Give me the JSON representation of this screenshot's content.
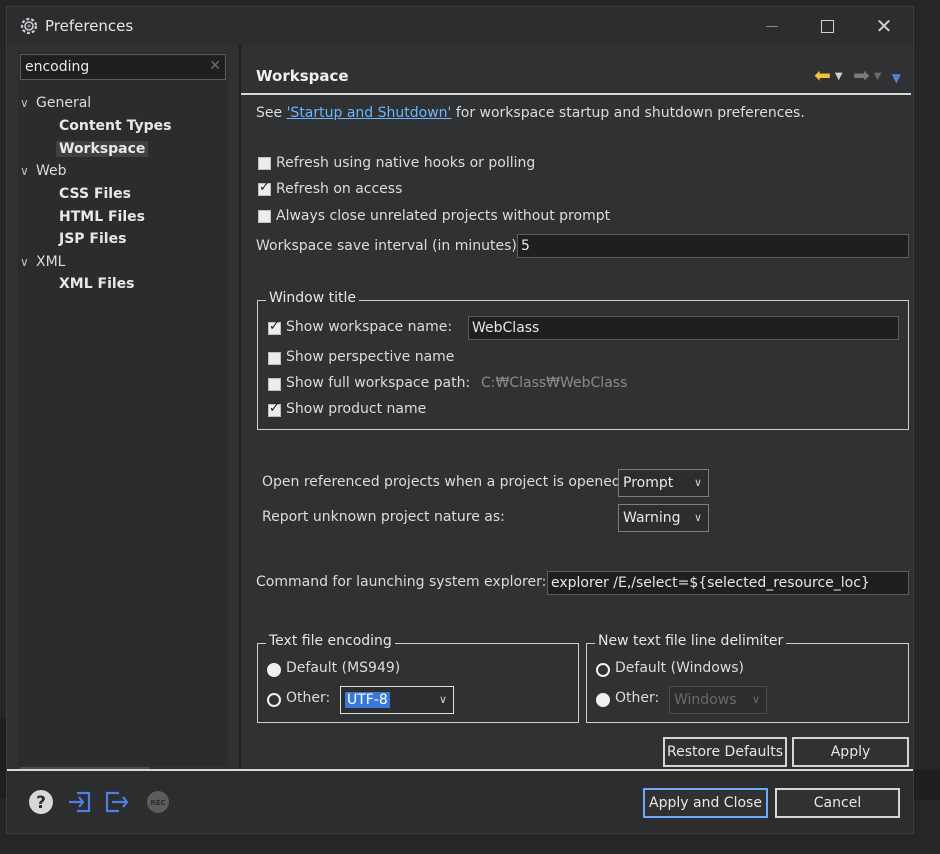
{
  "window": {
    "title": "Preferences"
  },
  "filter": {
    "value": "encoding"
  },
  "tree": [
    {
      "label": "General",
      "level": 0,
      "expanded": true
    },
    {
      "label": "Content Types",
      "level": 1
    },
    {
      "label": "Workspace",
      "level": 1,
      "selected": true
    },
    {
      "label": "Web",
      "level": 0,
      "expanded": true
    },
    {
      "label": "CSS Files",
      "level": 1
    },
    {
      "label": "HTML Files",
      "level": 1
    },
    {
      "label": "JSP Files",
      "level": 1
    },
    {
      "label": "XML",
      "level": 0,
      "expanded": true
    },
    {
      "label": "XML Files",
      "level": 1
    }
  ],
  "page": {
    "title": "Workspace",
    "intro_prefix": "See ",
    "intro_link": "'Startup and Shutdown'",
    "intro_suffix": " for workspace startup and shutdown preferences.",
    "refresh_native": {
      "label": "Refresh using native hooks or polling",
      "checked": false
    },
    "refresh_access": {
      "label": "Refresh on access",
      "checked": true
    },
    "always_close": {
      "label": "Always close unrelated projects without prompt",
      "checked": false
    },
    "save_interval": {
      "label": "Workspace save interval (in minutes):",
      "value": "5"
    },
    "window_title": {
      "group_label": "Window title",
      "show_workspace_name": {
        "label": "Show workspace name:",
        "checked": true,
        "value": "WebClass"
      },
      "show_perspective_name": {
        "label": "Show perspective name",
        "checked": false
      },
      "show_full_path": {
        "label": "Show full workspace path:",
        "checked": false,
        "value": "C:₩Class₩WebClass"
      },
      "show_product_name": {
        "label": "Show product name",
        "checked": true
      }
    },
    "open_referenced": {
      "label": "Open referenced projects when a project is opened:",
      "value": "Prompt"
    },
    "report_unknown": {
      "label": "Report unknown project nature as:",
      "value": "Warning"
    },
    "explorer_cmd": {
      "label": "Command for launching system explorer:",
      "value": "explorer /E,/select=${selected_resource_loc}"
    },
    "encoding": {
      "group_label": "Text file encoding",
      "default_label": "Default (MS949)",
      "other_label": "Other:",
      "other_value": "UTF-8"
    },
    "line_delim": {
      "group_label": "New text file line delimiter",
      "default_label": "Default (Windows)",
      "other_label": "Other:",
      "other_value": "Windows"
    },
    "restore_defaults": "Restore Defaults",
    "apply": "Apply"
  },
  "footer": {
    "icons": [
      "help-icon",
      "import-icon",
      "export-icon",
      "record-icon"
    ],
    "record_label": "REC",
    "apply_close": "Apply and Close",
    "cancel": "Cancel"
  },
  "colors": {
    "background": "#2f3133",
    "accent_link": "#6cb6ff",
    "selection": "#3b78d6",
    "back_arrow": "#f1c232",
    "focus_border": "#6ea8ff"
  }
}
